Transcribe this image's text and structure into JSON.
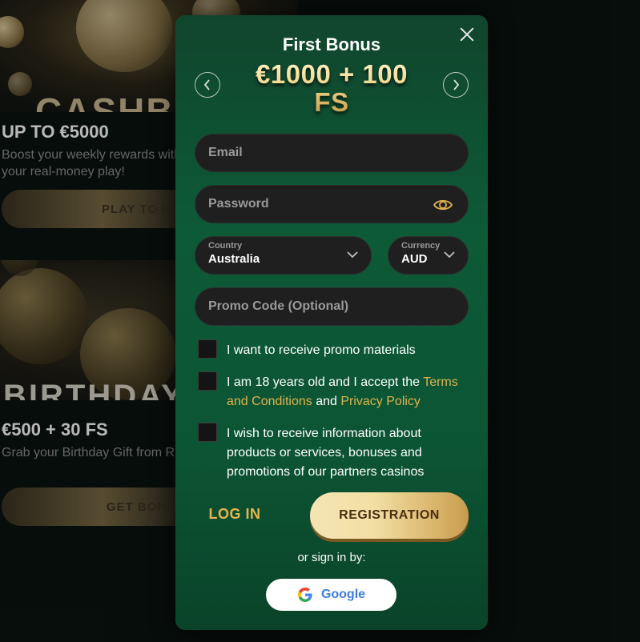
{
  "background": {
    "card1": {
      "art_word": "CASHB",
      "heading": "UP TO €5000",
      "desc_line1": "Boost your weekly rewards with",
      "desc_line2": "your real-money play!",
      "button": "PLAY TO EAR"
    },
    "card2": {
      "art_word": "BIRTHDAY B",
      "heading": "€500 + 30 FS",
      "desc": "Grab your Birthday Gift from Ri",
      "button": "GET BONUS"
    }
  },
  "modal": {
    "title": "First Bonus",
    "bonus_line1": "€1000 + 100",
    "bonus_line2": "FS",
    "email_placeholder": "Email",
    "password_placeholder": "Password",
    "country": {
      "label": "Country",
      "value": "Australia"
    },
    "currency": {
      "label": "Currency",
      "value": "AUD"
    },
    "promo_placeholder": "Promo Code (Optional)",
    "checks": {
      "promo": "I want to receive promo materials",
      "age_pre": "I am 18 years old and I accept the ",
      "age_terms": "Terms and Conditions",
      "age_and": " and ",
      "age_privacy": "Privacy Policy",
      "partners": "I wish to receive information about products or services, bonuses and promotions of our partners casinos"
    },
    "login_label": "LOG IN",
    "registration_label": "REGISTRATION",
    "or_sign_in": "or sign in by:",
    "google_label": "Google"
  },
  "colors": {
    "modal_green": "#0d5a37",
    "gold_link": "#e0b24f",
    "field_bg": "#1f1f1f"
  },
  "icons": [
    "close-icon",
    "chevron-left-icon",
    "chevron-right-icon",
    "eye-icon",
    "chevron-down-icon",
    "google-icon"
  ]
}
